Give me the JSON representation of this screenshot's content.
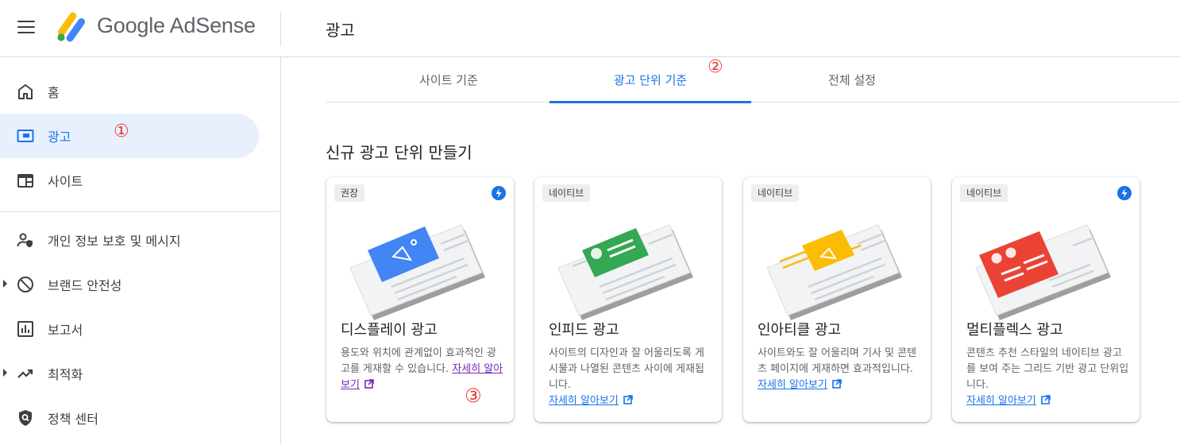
{
  "header": {
    "logo_text": "Google AdSense",
    "page_title": "광고"
  },
  "sidebar": {
    "items": [
      {
        "label": "홈",
        "icon": "home-icon"
      },
      {
        "label": "광고",
        "icon": "ads-icon",
        "active": true
      },
      {
        "label": "사이트",
        "icon": "sites-icon"
      },
      {
        "label": "개인 정보 보호 및 메시지",
        "icon": "privacy-icon"
      },
      {
        "label": "브랜드 안전성",
        "icon": "brand-safety-icon",
        "expandable": true
      },
      {
        "label": "보고서",
        "icon": "reports-icon"
      },
      {
        "label": "최적화",
        "icon": "optimization-icon",
        "expandable": true
      },
      {
        "label": "정책 센터",
        "icon": "policy-icon"
      }
    ]
  },
  "tabs": [
    {
      "label": "사이트 기준"
    },
    {
      "label": "광고 단위 기준",
      "active": true
    },
    {
      "label": "전체 설정"
    }
  ],
  "section_title": "신규 광고 단위 만들기",
  "cards": [
    {
      "chip": "권장",
      "title": "디스플레이 광고",
      "desc": "용도와 위치에 관계없이 효과적인 광고를 게재할 수 있습니다.",
      "link": "자세히 알아보기",
      "bolt": true,
      "accent": "#4285f4"
    },
    {
      "chip": "네이티브",
      "title": "인피드 광고",
      "desc": "사이트의 디자인과 잘 어울리도록 게시물과 나열된 콘텐츠 사이에 게재됩니다.",
      "link": "자세히 알아보기",
      "bolt": false,
      "accent": "#34a853"
    },
    {
      "chip": "네이티브",
      "title": "인아티클 광고",
      "desc": "사이트와도 잘 어울리며 기사 및 콘텐츠 페이지에 게재하면 효과적입니다.",
      "link": "자세히 알아보기",
      "bolt": false,
      "accent": "#fbbc04"
    },
    {
      "chip": "네이티브",
      "title": "멀티플렉스 광고",
      "desc": "콘텐츠 추천 스타일의 네이티브 광고를 보여 주는 그리드 기반 광고 단위입니다.",
      "link": "자세히 알아보기",
      "bolt": true,
      "accent": "#ea4335"
    }
  ],
  "annotations": [
    "①",
    "②",
    "③"
  ],
  "colors": {
    "accent_blue": "#1a73e8",
    "active_bg": "#e8f0fe",
    "annotation_red": "#e53935"
  }
}
